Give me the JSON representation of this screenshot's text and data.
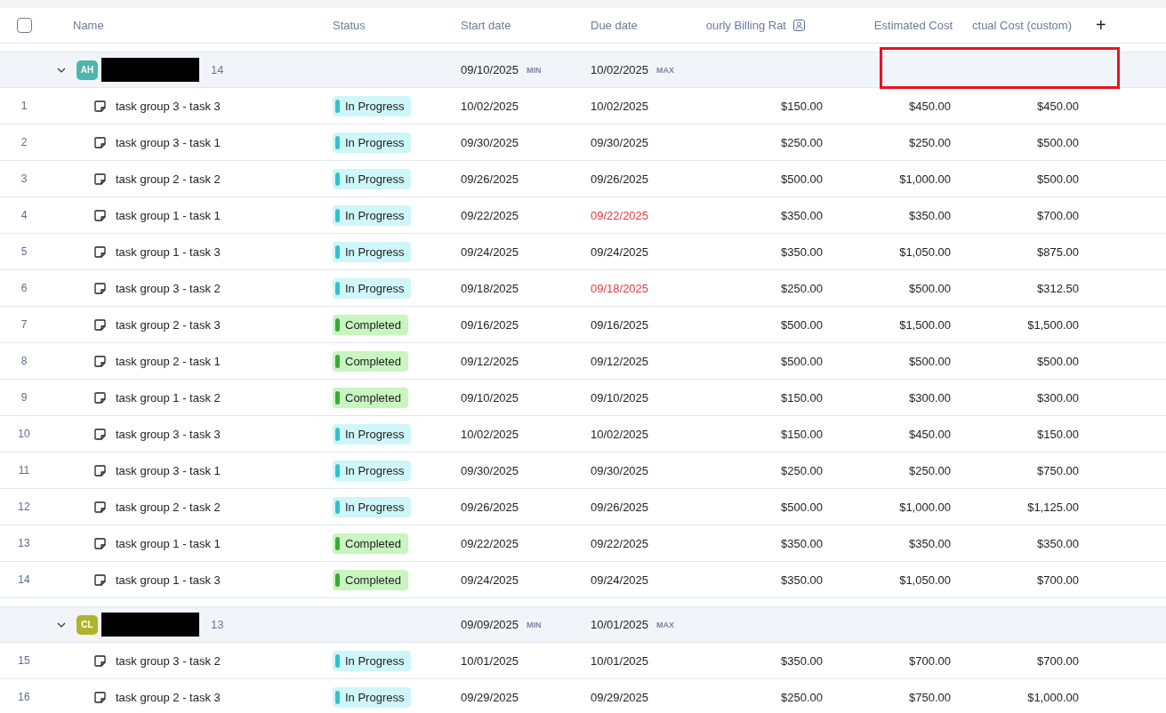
{
  "columns": [
    {
      "label": "Name"
    },
    {
      "label": "Status"
    },
    {
      "label": "Start date"
    },
    {
      "label": "Due date"
    },
    {
      "label": "ourly Billing Rat",
      "has_icon": true
    },
    {
      "label": "Estimated Cost"
    },
    {
      "label": "ctual Cost (custom)"
    }
  ],
  "add_column": "+",
  "select_all_checked": false,
  "groups": [
    {
      "avatar": "AH",
      "color": "#4db6ac",
      "count": "14",
      "expanded": true,
      "highlighted": true,
      "start": "09/10/2025",
      "start_tag": "MIN",
      "due": "10/02/2025",
      "due_tag": "MAX",
      "rows": [
        {
          "num": "1",
          "name": "task group 3 - task 3",
          "kind": "in_progress",
          "status": "In Progress",
          "start": "10/02/2025",
          "due": "10/02/2025",
          "overdue": false,
          "rate": "$150.00",
          "est": "$450.00",
          "actual": "$450.00"
        },
        {
          "num": "2",
          "name": "task group 3 - task 1",
          "kind": "in_progress",
          "status": "In Progress",
          "start": "09/30/2025",
          "due": "09/30/2025",
          "overdue": false,
          "rate": "$250.00",
          "est": "$250.00",
          "actual": "$500.00"
        },
        {
          "num": "3",
          "name": "task group 2 - task 2",
          "kind": "in_progress",
          "status": "In Progress",
          "start": "09/26/2025",
          "due": "09/26/2025",
          "overdue": false,
          "rate": "$500.00",
          "est": "$1,000.00",
          "actual": "$500.00"
        },
        {
          "num": "4",
          "name": "task group 1 - task 1",
          "kind": "in_progress",
          "status": "In Progress",
          "start": "09/22/2025",
          "due": "09/22/2025",
          "overdue": true,
          "rate": "$350.00",
          "est": "$350.00",
          "actual": "$700.00"
        },
        {
          "num": "5",
          "name": "task group 1 - task 3",
          "kind": "in_progress",
          "status": "In Progress",
          "start": "09/24/2025",
          "due": "09/24/2025",
          "overdue": false,
          "rate": "$350.00",
          "est": "$1,050.00",
          "actual": "$875.00"
        },
        {
          "num": "6",
          "name": "task group 3 - task 2",
          "kind": "in_progress",
          "status": "In Progress",
          "start": "09/18/2025",
          "due": "09/18/2025",
          "overdue": true,
          "rate": "$250.00",
          "est": "$500.00",
          "actual": "$312.50"
        },
        {
          "num": "7",
          "name": "task group 2 - task 3",
          "kind": "completed",
          "status": "Completed",
          "start": "09/16/2025",
          "due": "09/16/2025",
          "overdue": false,
          "rate": "$500.00",
          "est": "$1,500.00",
          "actual": "$1,500.00"
        },
        {
          "num": "8",
          "name": "task group 2 - task 1",
          "kind": "completed",
          "status": "Completed",
          "start": "09/12/2025",
          "due": "09/12/2025",
          "overdue": false,
          "rate": "$500.00",
          "est": "$500.00",
          "actual": "$500.00"
        },
        {
          "num": "9",
          "name": "task group 1 - task 2",
          "kind": "completed",
          "status": "Completed",
          "start": "09/10/2025",
          "due": "09/10/2025",
          "overdue": false,
          "rate": "$150.00",
          "est": "$300.00",
          "actual": "$300.00"
        },
        {
          "num": "10",
          "name": "task group 3 - task 3",
          "kind": "in_progress",
          "status": "In Progress",
          "start": "10/02/2025",
          "due": "10/02/2025",
          "overdue": false,
          "rate": "$150.00",
          "est": "$450.00",
          "actual": "$150.00"
        },
        {
          "num": "11",
          "name": "task group 3 - task 1",
          "kind": "in_progress",
          "status": "In Progress",
          "start": "09/30/2025",
          "due": "09/30/2025",
          "overdue": false,
          "rate": "$250.00",
          "est": "$250.00",
          "actual": "$750.00"
        },
        {
          "num": "12",
          "name": "task group 2 - task 2",
          "kind": "in_progress",
          "status": "In Progress",
          "start": "09/26/2025",
          "due": "09/26/2025",
          "overdue": false,
          "rate": "$500.00",
          "est": "$1,000.00",
          "actual": "$1,125.00"
        },
        {
          "num": "13",
          "name": "task group 1 - task 1",
          "kind": "completed",
          "status": "Completed",
          "start": "09/22/2025",
          "due": "09/22/2025",
          "overdue": false,
          "rate": "$350.00",
          "est": "$350.00",
          "actual": "$350.00"
        },
        {
          "num": "14",
          "name": "task group 1 - task 3",
          "kind": "completed",
          "status": "Completed",
          "start": "09/24/2025",
          "due": "09/24/2025",
          "overdue": false,
          "rate": "$350.00",
          "est": "$1,050.00",
          "actual": "$700.00"
        }
      ]
    },
    {
      "avatar": "CL",
      "color": "#afb42b",
      "count": "13",
      "expanded": true,
      "highlighted": false,
      "start": "09/09/2025",
      "start_tag": "MIN",
      "due": "10/01/2025",
      "due_tag": "MAX",
      "rows": [
        {
          "num": "15",
          "name": "task group 3 - task 2",
          "kind": "in_progress",
          "status": "In Progress",
          "start": "10/01/2025",
          "due": "10/01/2025",
          "overdue": false,
          "rate": "$350.00",
          "est": "$700.00",
          "actual": "$700.00"
        },
        {
          "num": "16",
          "name": "task group 2 - task 3",
          "kind": "in_progress",
          "status": "In Progress",
          "start": "09/29/2025",
          "due": "09/29/2025",
          "overdue": false,
          "rate": "$250.00",
          "est": "$750.00",
          "actual": "$1,000.00"
        }
      ]
    }
  ]
}
